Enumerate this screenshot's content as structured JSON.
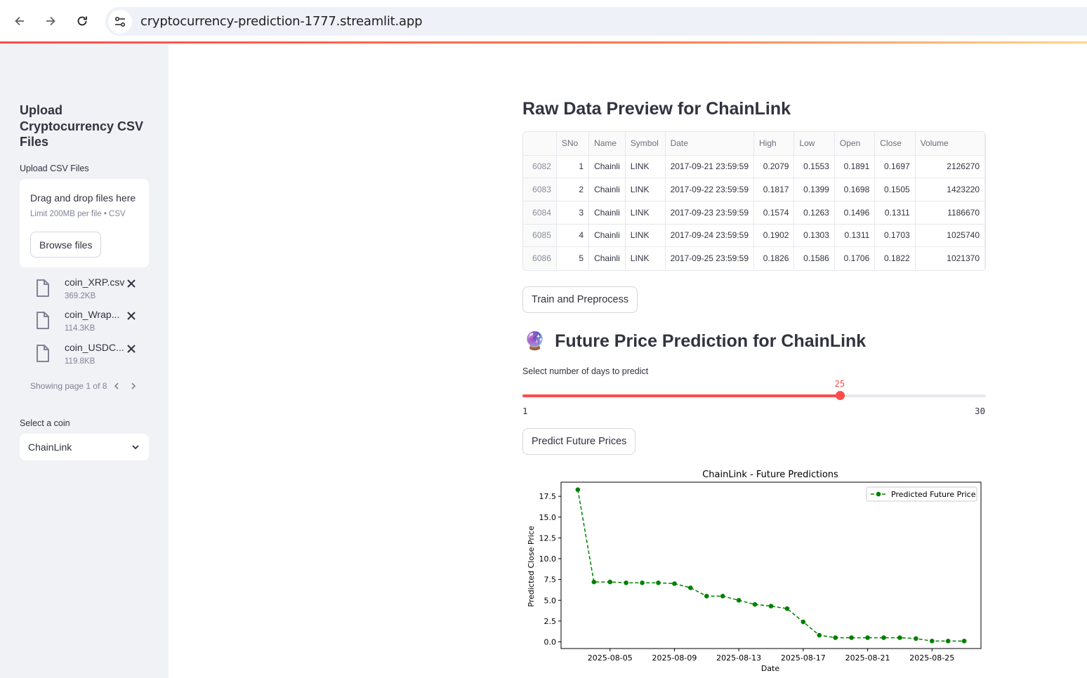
{
  "browser": {
    "url": "cryptocurrency-prediction-1777.streamlit.app"
  },
  "sidebar": {
    "title": "Upload Cryptocurrency CSV Files",
    "upload_label": "Upload CSV Files",
    "dropzone": {
      "title": "Drag and drop files here",
      "limit": "Limit 200MB per file • CSV",
      "browse_label": "Browse files"
    },
    "files": [
      {
        "name": "coin_XRP.csv",
        "size": "369.2KB"
      },
      {
        "name": "coin_Wrap...",
        "size": "114.3KB"
      },
      {
        "name": "coin_USDC...",
        "size": "119.8KB"
      }
    ],
    "pager": "Showing page 1 of 8",
    "select_label": "Select a coin",
    "selected_coin": "ChainLink"
  },
  "main": {
    "raw_title": "Raw Data Preview for ChainLink",
    "table": {
      "columns": [
        "",
        "SNo",
        "Name",
        "Symbol",
        "Date",
        "High",
        "Low",
        "Open",
        "Close",
        "Volume"
      ],
      "rows": [
        [
          "6082",
          "1",
          "Chainli",
          "LINK",
          "2017-09-21 23:59:59",
          "0.2079",
          "0.1553",
          "0.1891",
          "0.1697",
          "2126270"
        ],
        [
          "6083",
          "2",
          "Chainli",
          "LINK",
          "2017-09-22 23:59:59",
          "0.1817",
          "0.1399",
          "0.1698",
          "0.1505",
          "1423220"
        ],
        [
          "6084",
          "3",
          "Chainli",
          "LINK",
          "2017-09-23 23:59:59",
          "0.1574",
          "0.1263",
          "0.1496",
          "0.1311",
          "1186670"
        ],
        [
          "6085",
          "4",
          "Chainli",
          "LINK",
          "2017-09-24 23:59:59",
          "0.1902",
          "0.1303",
          "0.1311",
          "0.1703",
          "1025740"
        ],
        [
          "6086",
          "5",
          "Chainli",
          "LINK",
          "2017-09-25 23:59:59",
          "0.1826",
          "0.1586",
          "0.1706",
          "0.1822",
          "1021370"
        ]
      ]
    },
    "train_button": "Train and Preprocess",
    "prediction_emoji": "🔮",
    "prediction_title": "Future Price Prediction for ChainLink",
    "slider": {
      "label": "Select number of days to predict",
      "min": 1,
      "max": 30,
      "value": 25
    },
    "predict_button": "Predict Future Prices"
  },
  "chart_data": {
    "type": "line",
    "title": "ChainLink - Future Predictions",
    "xlabel": "Date",
    "ylabel": "Predicted Close Price",
    "x": [
      "2025-08-03",
      "2025-08-04",
      "2025-08-05",
      "2025-08-06",
      "2025-08-07",
      "2025-08-08",
      "2025-08-09",
      "2025-08-10",
      "2025-08-11",
      "2025-08-12",
      "2025-08-13",
      "2025-08-14",
      "2025-08-15",
      "2025-08-16",
      "2025-08-17",
      "2025-08-18",
      "2025-08-19",
      "2025-08-20",
      "2025-08-21",
      "2025-08-22",
      "2025-08-23",
      "2025-08-24",
      "2025-08-25",
      "2025-08-26",
      "2025-08-27"
    ],
    "series": [
      {
        "name": "Predicted Future Price",
        "color": "#008000",
        "values": [
          18.3,
          7.2,
          7.2,
          7.1,
          7.1,
          7.1,
          7.0,
          6.5,
          5.5,
          5.5,
          5.0,
          4.5,
          4.3,
          4.0,
          2.4,
          0.8,
          0.5,
          0.5,
          0.5,
          0.5,
          0.5,
          0.4,
          0.1,
          0.1,
          0.1
        ]
      }
    ],
    "xticks": [
      "2025-08-05",
      "2025-08-09",
      "2025-08-13",
      "2025-08-17",
      "2025-08-21",
      "2025-08-25"
    ],
    "yticks": [
      "0.0",
      "2.5",
      "5.0",
      "7.5",
      "10.0",
      "12.5",
      "15.0",
      "17.5"
    ],
    "xlim": [
      "2025-08-01T23:00",
      "2025-08-28T01:00"
    ],
    "ylim": [
      -0.8,
      19.2
    ],
    "legend_position": "upper right",
    "grid": false
  }
}
